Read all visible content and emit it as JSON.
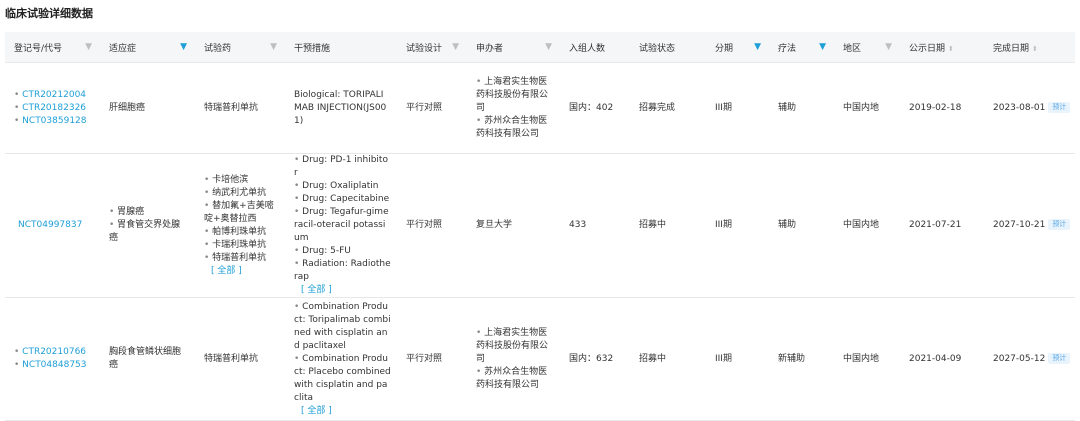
{
  "page": {
    "title": "临床试验详细数据"
  },
  "columns": [
    {
      "label": "登记号/代号",
      "icon": "filter-icon",
      "active": false,
      "sort": false
    },
    {
      "label": "适应症",
      "icon": "filter-icon",
      "active": true,
      "sort": false
    },
    {
      "label": "试验药",
      "icon": "filter-icon",
      "active": false,
      "sort": false
    },
    {
      "label": "干预措施",
      "icon": "",
      "active": false,
      "sort": false
    },
    {
      "label": "试验设计",
      "icon": "filter-icon",
      "active": false,
      "sort": false
    },
    {
      "label": "申办者",
      "icon": "filter-icon",
      "active": false,
      "sort": false
    },
    {
      "label": "入组人数",
      "icon": "",
      "active": false,
      "sort": false
    },
    {
      "label": "试验状态",
      "icon": "",
      "active": false,
      "sort": false
    },
    {
      "label": "分期",
      "icon": "filter-icon",
      "active": true,
      "sort": false
    },
    {
      "label": "疗法",
      "icon": "filter-icon",
      "active": true,
      "sort": false
    },
    {
      "label": "地区",
      "icon": "filter-icon",
      "active": false,
      "sort": false
    },
    {
      "label": "公示日期",
      "icon": "",
      "active": false,
      "sort": true
    },
    {
      "label": "完成日期",
      "icon": "",
      "active": false,
      "sort": true
    }
  ],
  "rows": [
    {
      "ids": [
        "CTR20212004",
        "CTR20182326",
        "NCT03859128"
      ],
      "indication": "肝细胞癌",
      "indications": [],
      "drugs": [
        "特瑞普利单抗"
      ],
      "drug_bulleted": false,
      "intervention": [
        "Biological: TORIPALIMAB INJECTION(JS001)"
      ],
      "intervention_bulleted": false,
      "design": "平行对照",
      "sponsors": [
        "上海君实生物医药科技股份有限公司",
        "苏州众合生物医药科技有限公司"
      ],
      "enrollment": "国内：402",
      "status": "招募完成",
      "phase": "III期",
      "therapy": "辅助",
      "region": "中国内地",
      "publish_date": "2019-02-18",
      "completion_date": "2023-08-01",
      "tag": "预计"
    },
    {
      "ids": [
        "NCT04997837"
      ],
      "indication": "",
      "indications": [
        "胃腺癌",
        "胃食管交界处腺癌"
      ],
      "drugs": [
        "卡培他滨",
        "纳武利尤单抗",
        "替加氟+吉美嘧啶+奥替拉西",
        "帕博利珠单抗",
        "卡瑞利珠单抗",
        "特瑞普利单抗"
      ],
      "drug_bulleted": true,
      "intervention": [
        "Drug: PD-1 inhibitor",
        "Drug: Oxaliplatin",
        "Drug: Capecitabine",
        "Drug: Tegafur-gimeracil-oteracil potassium",
        "Drug: 5-FU",
        "Radiation: Radiotherap"
      ],
      "intervention_bulleted": true,
      "design": "平行对照",
      "sponsors": [],
      "sponsor": "复旦大学",
      "enrollment": "433",
      "status": "招募中",
      "phase": "III期",
      "therapy": "辅助",
      "region": "中国内地",
      "publish_date": "2021-07-21",
      "completion_date": "2027-10-21",
      "tag": "预计",
      "more": "[ 全部 ]"
    },
    {
      "ids": [
        "CTR20210766",
        "NCT04848753"
      ],
      "indication": "胸段食管鳞状细胞癌",
      "indications": [],
      "drugs": [
        "特瑞普利单抗"
      ],
      "drug_bulleted": false,
      "intervention": [
        "Combination Product: Toripalimab combined with cisplatin and paclitaxel",
        "Combination Product: Placebo combined with cisplatin and paclita"
      ],
      "intervention_bulleted": true,
      "design": "平行对照",
      "sponsors": [
        "上海君实生物医药科技股份有限公司",
        "苏州众合生物医药科技有限公司"
      ],
      "enrollment": "国内：632",
      "status": "招募中",
      "phase": "III期",
      "therapy": "新辅助",
      "region": "中国内地",
      "publish_date": "2021-04-09",
      "completion_date": "2027-05-12",
      "tag": "预计",
      "more": "[ 全部 ]"
    }
  ],
  "colors": {
    "link": "#1e9fd7",
    "header_bg": "#f5f6f7",
    "tag_bg": "#e8f3fc"
  }
}
